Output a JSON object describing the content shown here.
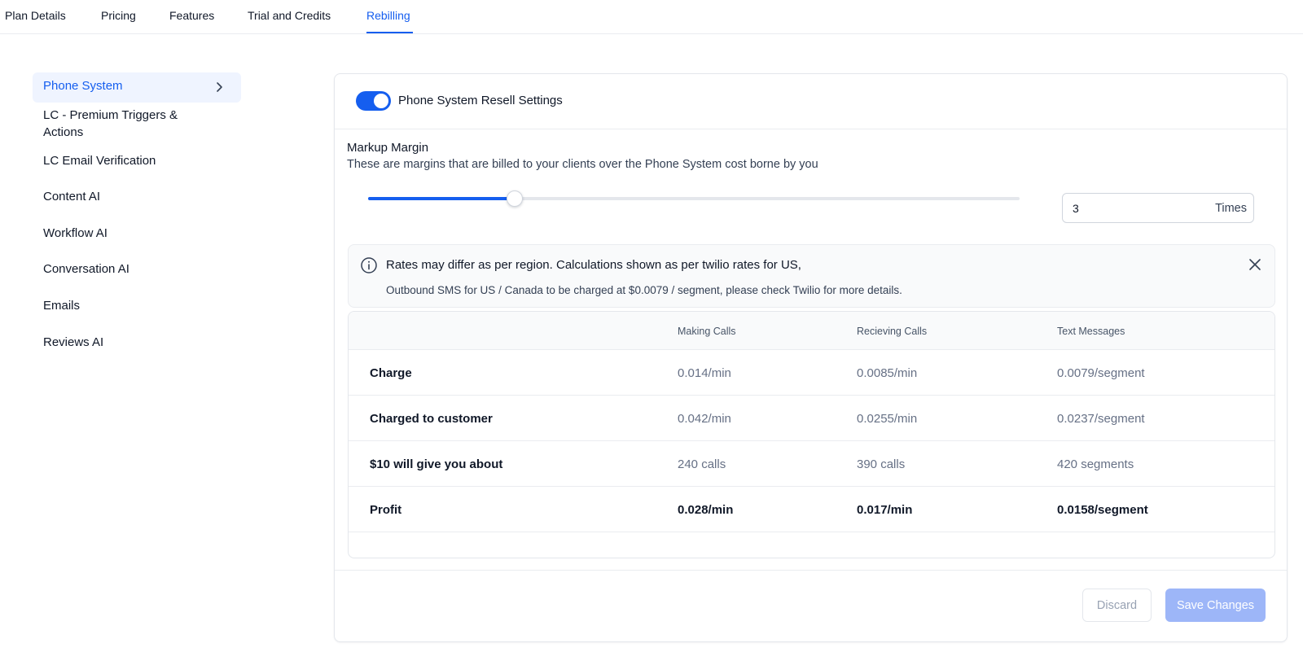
{
  "tabs": [
    {
      "label": "Plan Details",
      "active": false
    },
    {
      "label": "Pricing",
      "active": false
    },
    {
      "label": "Features",
      "active": false
    },
    {
      "label": "Trial and Credits",
      "active": false
    },
    {
      "label": "Rebilling",
      "active": true
    }
  ],
  "sidebar": {
    "items": [
      {
        "label": "Phone System",
        "active": true
      },
      {
        "label": "LC - Premium Triggers & Actions"
      },
      {
        "label": "LC Email Verification"
      },
      {
        "label": "Content AI"
      },
      {
        "label": "Workflow AI"
      },
      {
        "label": "Conversation AI"
      },
      {
        "label": "Emails"
      },
      {
        "label": "Reviews AI"
      }
    ]
  },
  "settings": {
    "toggle_on": true,
    "title": "Phone System Resell Settings",
    "markup_title": "Markup Margin",
    "markup_description": "These are margins that are billed to your clients over the Phone System cost borne by you",
    "slider_fraction": 0.225,
    "multiplier_value": "3",
    "multiplier_suffix": "Times"
  },
  "alert": {
    "line1": "Rates may differ as per region. Calculations shown as per twilio rates for US,",
    "line2": "Outbound SMS for US / Canada to be charged at $0.0079 / segment, please check Twilio for more details."
  },
  "table": {
    "headers": [
      "",
      "Making Calls",
      "Recieving Calls",
      "Text Messages"
    ],
    "rows": [
      {
        "label": "Charge",
        "values": [
          "0.014/min",
          "0.0085/min",
          "0.0079/segment"
        ],
        "bold": false
      },
      {
        "label": "Charged to customer",
        "values": [
          "0.042/min",
          "0.0255/min",
          "0.0237/segment"
        ],
        "bold": false
      },
      {
        "label": "$10 will give you about",
        "values": [
          "240 calls",
          "390 calls",
          "420 segments"
        ],
        "bold": false
      },
      {
        "label": "Profit",
        "values": [
          "0.028/min",
          "0.017/min",
          "0.0158/segment"
        ],
        "bold": true
      }
    ]
  },
  "actions": {
    "discard_label": "Discard",
    "save_label": "Save Changes"
  },
  "colors": {
    "accent": "#155eef",
    "save_disabled": "#9db6f8"
  }
}
